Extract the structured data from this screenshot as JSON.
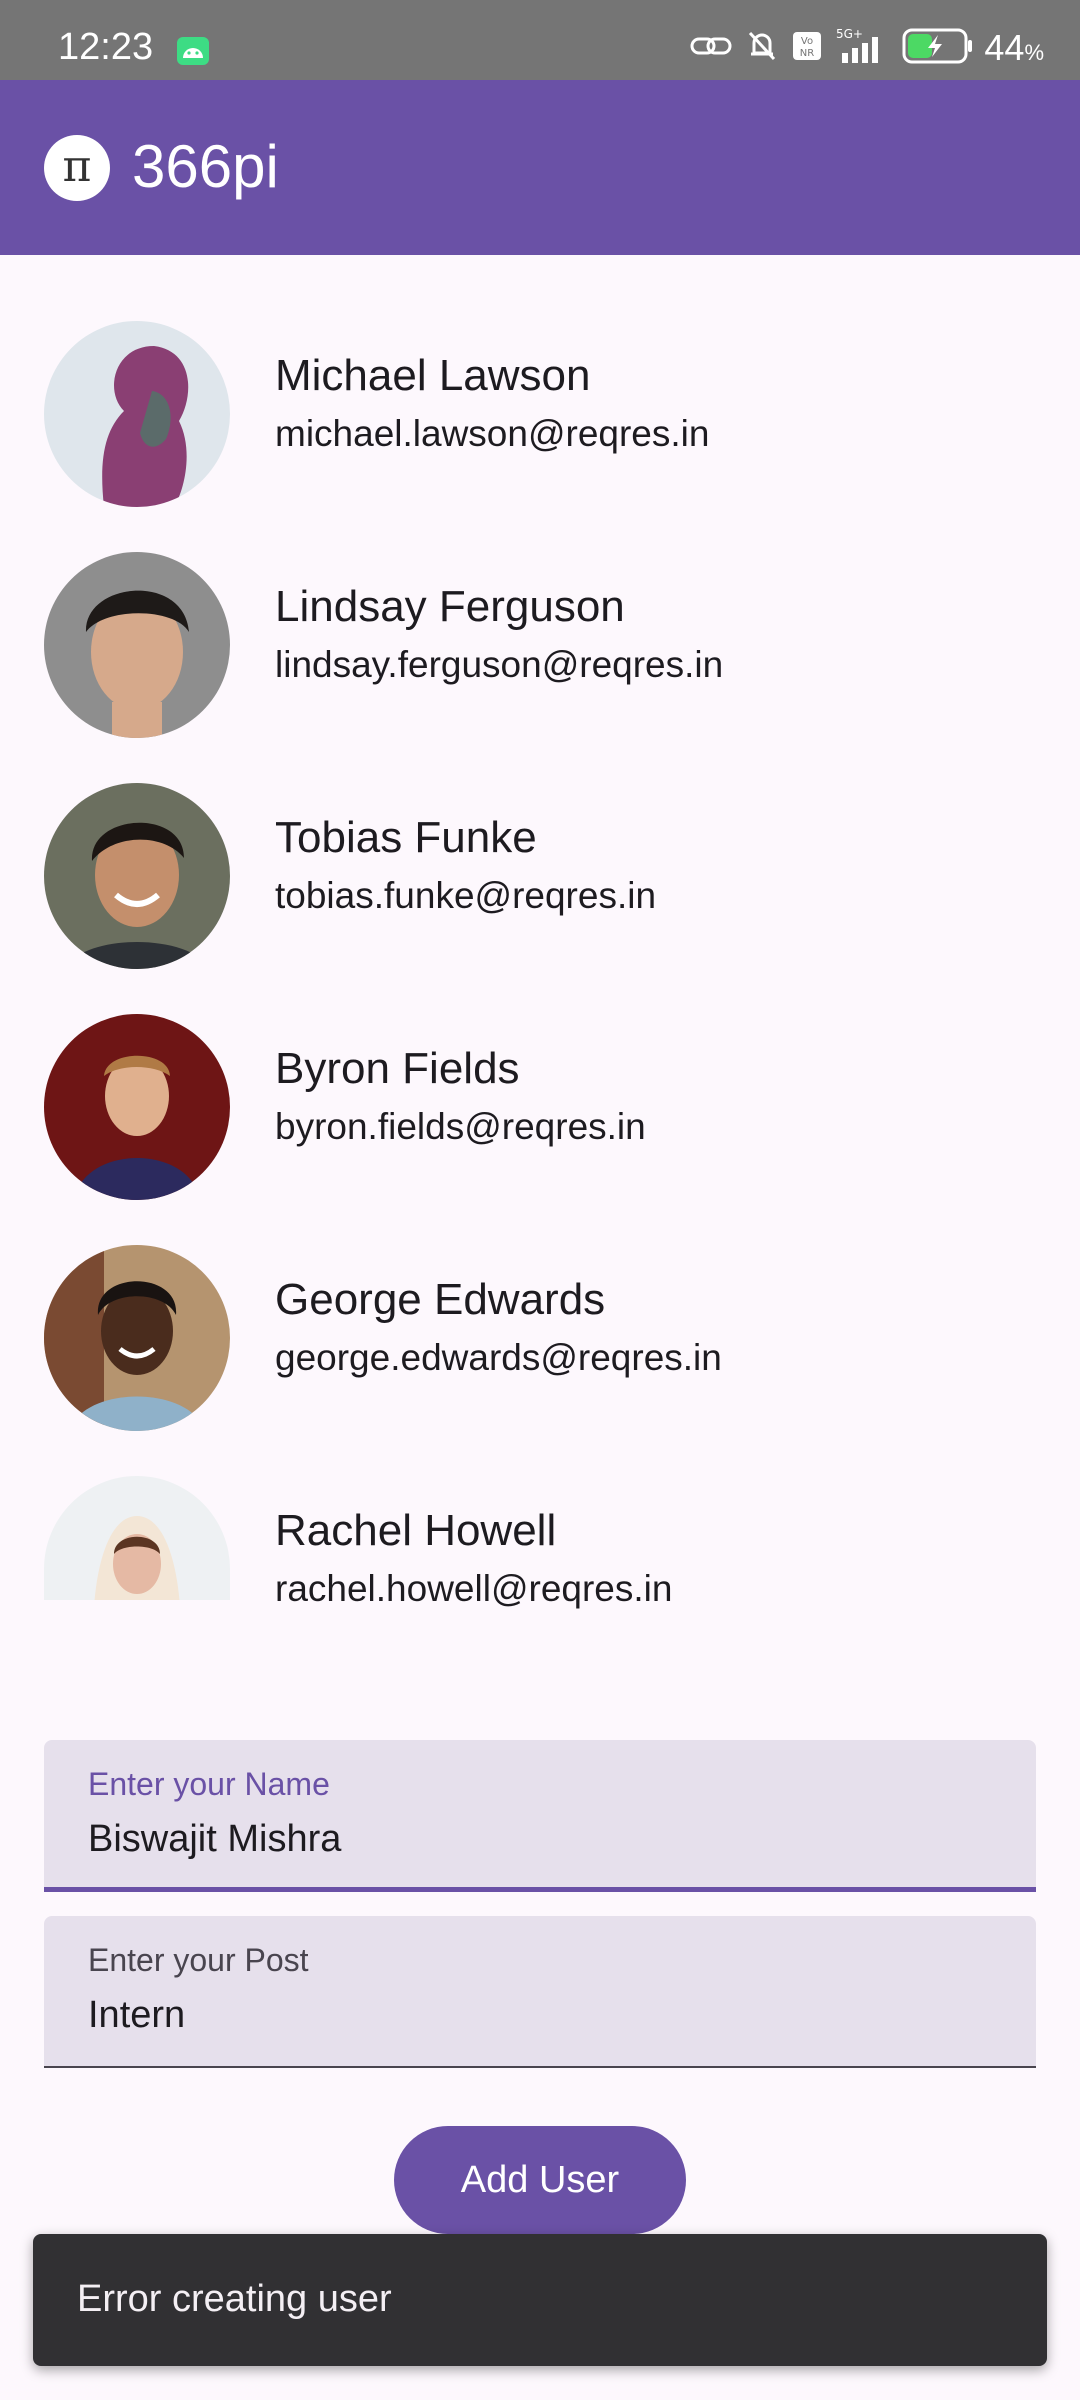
{
  "status_bar": {
    "time": "12:23",
    "network": "5G+",
    "battery_percent": "44",
    "battery_unit": "%",
    "battery_level": 0.44,
    "icons": [
      "android-icon",
      "link-icon",
      "bell-off-icon",
      "vonr-icon",
      "signal-icon",
      "battery-icon"
    ]
  },
  "app_bar": {
    "logo_glyph": "π",
    "title": "366pi",
    "color": "#6a51a6"
  },
  "users": [
    {
      "name": "Michael Lawson",
      "email": "michael.lawson@reqres.in"
    },
    {
      "name": "Lindsay Ferguson",
      "email": "lindsay.ferguson@reqres.in"
    },
    {
      "name": "Tobias Funke",
      "email": "tobias.funke@reqres.in"
    },
    {
      "name": "Byron Fields",
      "email": "byron.fields@reqres.in"
    },
    {
      "name": "George Edwards",
      "email": "george.edwards@reqres.in"
    },
    {
      "name": "Rachel Howell",
      "email": "rachel.howell@reqres.in"
    }
  ],
  "form": {
    "name_label": "Enter your Name",
    "name_value": "Biswajit Mishra",
    "post_label": "Enter your Post",
    "post_value": "Intern",
    "submit_label": "Add User"
  },
  "snackbar": {
    "message": "Error creating user"
  }
}
